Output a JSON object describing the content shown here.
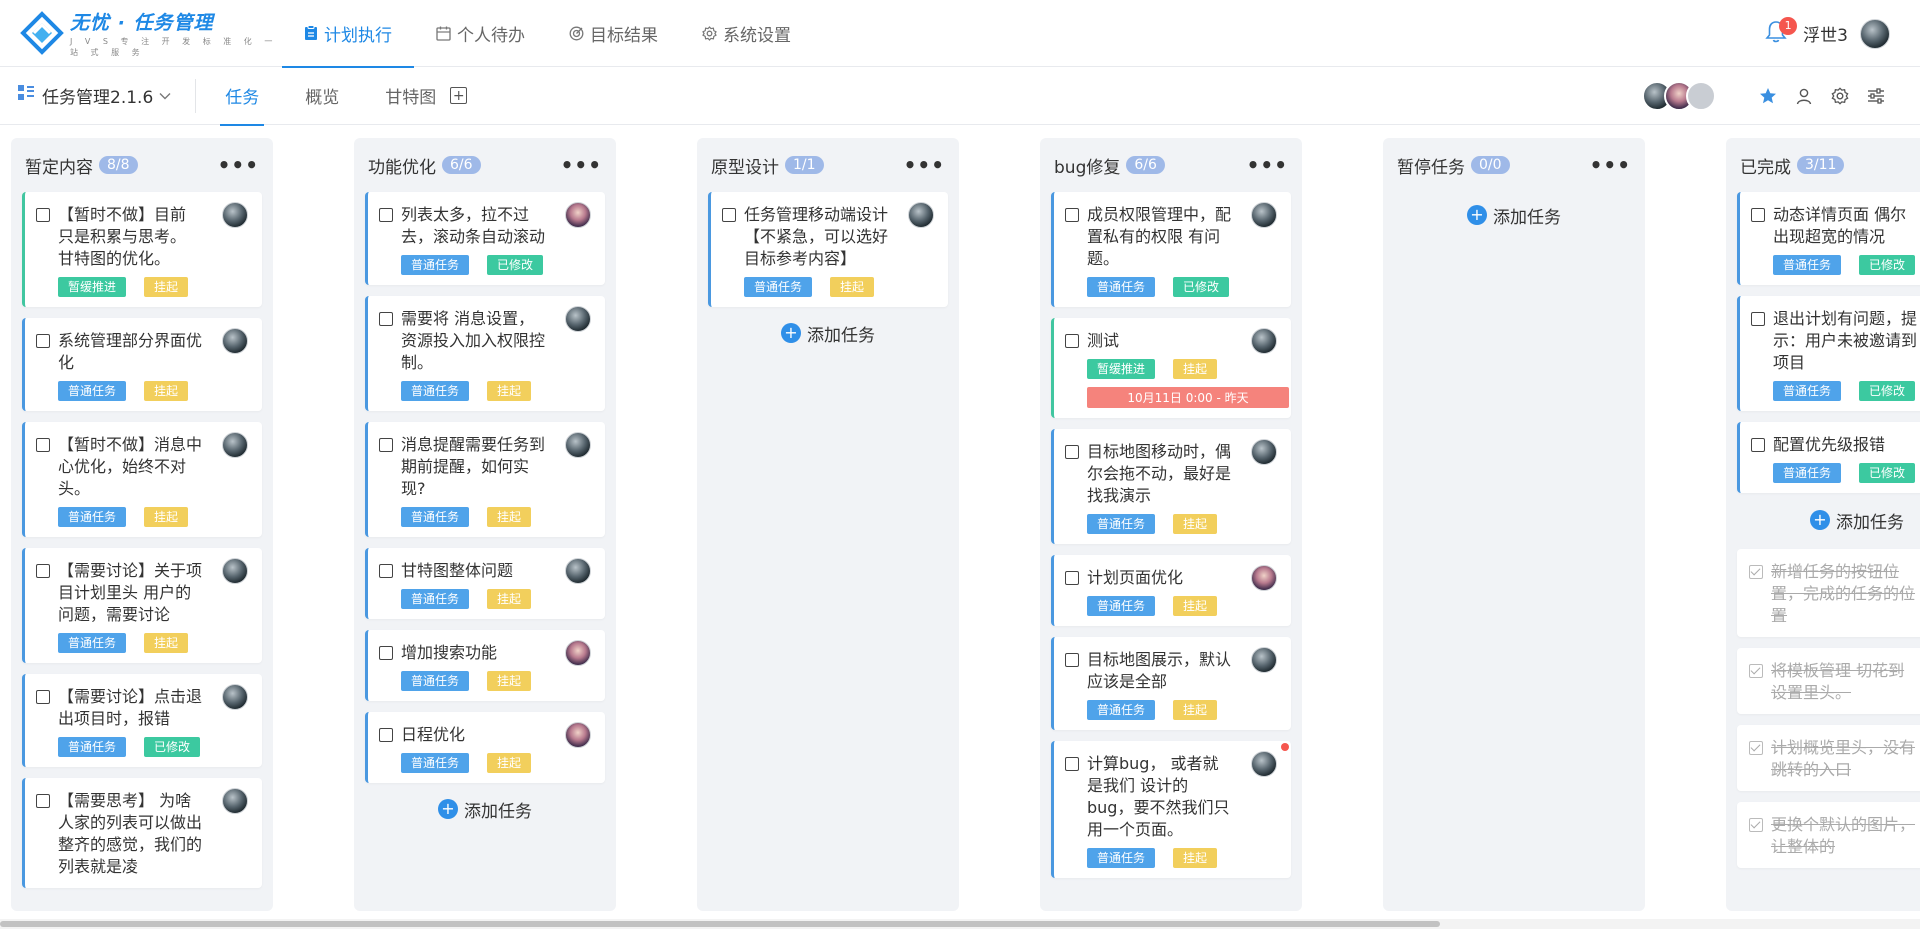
{
  "app": {
    "logo_title": "无忧 · 任务管理",
    "logo_subtitle": "J V S 专 注 开 发 标 准 化 一 站 式 服 务"
  },
  "nav": [
    {
      "label": "计划执行",
      "icon": "clipboard-icon",
      "active": true
    },
    {
      "label": "个人待办",
      "icon": "calendar-icon",
      "active": false
    },
    {
      "label": "目标结果",
      "icon": "target-icon",
      "active": false
    },
    {
      "label": "系统设置",
      "icon": "gear-icon",
      "active": false
    }
  ],
  "user": {
    "name": "浮世3",
    "notifications": "1"
  },
  "project": {
    "name": "任务管理2.1.6"
  },
  "subtabs": [
    {
      "label": "任务",
      "active": true
    },
    {
      "label": "概览",
      "active": false
    },
    {
      "label": "甘特图",
      "active": false
    }
  ],
  "colors": {
    "accent": "#1e88e5",
    "tag_blue": "#4fa3ea",
    "tag_green": "#3cc9a0",
    "tag_yellow": "#f2cf5c",
    "due_red": "#f5837c"
  },
  "add_task_label": "添加任务",
  "columns": [
    {
      "title": "暂定内容",
      "count": "8/8",
      "cards": [
        {
          "title": "【暂时不做】目前 只是积累与思考。 甘特图的优化。",
          "accent": "green",
          "tags": [
            {
              "t": "暂缓推进",
              "c": "green"
            },
            {
              "t": "挂起",
              "c": "yellow"
            }
          ]
        },
        {
          "title": "系统管理部分界面优化",
          "accent": "blue",
          "tags": [
            {
              "t": "普通任务",
              "c": "blue"
            },
            {
              "t": "挂起",
              "c": "yellow"
            }
          ]
        },
        {
          "title": "【暂时不做】消息中心优化，始终不对头。",
          "accent": "blue",
          "tags": [
            {
              "t": "普通任务",
              "c": "blue"
            },
            {
              "t": "挂起",
              "c": "yellow"
            }
          ]
        },
        {
          "title": "【需要讨论】关于项目计划里头 用户的问题，需要讨论",
          "accent": "blue",
          "tags": [
            {
              "t": "普通任务",
              "c": "blue"
            },
            {
              "t": "挂起",
              "c": "yellow"
            }
          ]
        },
        {
          "title": "【需要讨论】点击退出项目时，报错",
          "accent": "blue",
          "tags": [
            {
              "t": "普通任务",
              "c": "blue"
            },
            {
              "t": "已修改",
              "c": "green"
            }
          ]
        },
        {
          "title": "【需要思考】 为啥人家的列表可以做出整齐的感觉，我们的列表就是凌",
          "accent": "blue",
          "tags": []
        }
      ]
    },
    {
      "title": "功能优化",
      "count": "6/6",
      "add": true,
      "cards": [
        {
          "title": "列表太多，拉不过去，滚动条自动滚动",
          "accent": "blue",
          "avatar": "b",
          "tags": [
            {
              "t": "普通任务",
              "c": "blue"
            },
            {
              "t": "已修改",
              "c": "green"
            }
          ]
        },
        {
          "title": "需要将 消息设置，资源投入加入权限控制。",
          "accent": "blue",
          "tags": [
            {
              "t": "普通任务",
              "c": "blue"
            },
            {
              "t": "挂起",
              "c": "yellow"
            }
          ]
        },
        {
          "title": "消息提醒需要任务到期前提醒，如何实现?",
          "accent": "blue",
          "tags": [
            {
              "t": "普通任务",
              "c": "blue"
            },
            {
              "t": "挂起",
              "c": "yellow"
            }
          ]
        },
        {
          "title": "甘特图整体问题",
          "accent": "blue",
          "tags": [
            {
              "t": "普通任务",
              "c": "blue"
            },
            {
              "t": "挂起",
              "c": "yellow"
            }
          ]
        },
        {
          "title": "增加搜索功能",
          "accent": "blue",
          "avatar": "b",
          "tags": [
            {
              "t": "普通任务",
              "c": "blue"
            },
            {
              "t": "挂起",
              "c": "yellow"
            }
          ]
        },
        {
          "title": "日程优化",
          "accent": "blue",
          "avatar": "b",
          "tags": [
            {
              "t": "普通任务",
              "c": "blue"
            },
            {
              "t": "挂起",
              "c": "yellow"
            }
          ]
        }
      ]
    },
    {
      "title": "原型设计",
      "count": "1/1",
      "add": true,
      "cards": [
        {
          "title": "任务管理移动端设计【不紧急，可以选好 目标参考内容】",
          "accent": "blue",
          "tags": [
            {
              "t": "普通任务",
              "c": "blue"
            },
            {
              "t": "挂起",
              "c": "yellow"
            }
          ]
        }
      ]
    },
    {
      "title": "bug修复",
      "count": "6/6",
      "cards": [
        {
          "title": "成员权限管理中，配置私有的权限 有问题。",
          "accent": "blue",
          "tags": [
            {
              "t": "普通任务",
              "c": "blue"
            },
            {
              "t": "已修改",
              "c": "green"
            }
          ]
        },
        {
          "title": "测试",
          "accent": "green",
          "tags": [
            {
              "t": "暂缓推进",
              "c": "green"
            },
            {
              "t": "挂起",
              "c": "yellow"
            }
          ],
          "due": "10月11日 0:00 - 昨天"
        },
        {
          "title": "目标地图移动时，偶尔会拖不动，最好是找我演示",
          "accent": "blue",
          "tags": [
            {
              "t": "普通任务",
              "c": "blue"
            },
            {
              "t": "挂起",
              "c": "yellow"
            }
          ]
        },
        {
          "title": "计划页面优化",
          "accent": "blue",
          "avatar": "b",
          "tags": [
            {
              "t": "普通任务",
              "c": "blue"
            },
            {
              "t": "挂起",
              "c": "yellow"
            }
          ]
        },
        {
          "title": "目标地图展示，默认应该是全部",
          "accent": "blue",
          "tags": [
            {
              "t": "普通任务",
              "c": "blue"
            },
            {
              "t": "挂起",
              "c": "yellow"
            }
          ]
        },
        {
          "title": "计算bug， 或者就是我们 设计的bug，要不然我们只用一个页面。",
          "accent": "blue",
          "dot": true,
          "tags": [
            {
              "t": "普通任务",
              "c": "blue"
            },
            {
              "t": "挂起",
              "c": "yellow"
            }
          ]
        }
      ]
    },
    {
      "title": "暂停任务",
      "count": "0/0",
      "add": true,
      "add_top": true,
      "cards": []
    },
    {
      "title": "已完成",
      "count": "3/11",
      "add": true,
      "cards": [
        {
          "title": "动态详情页面 偶尔出现超宽的情况",
          "accent": "blue",
          "tags": [
            {
              "t": "普通任务",
              "c": "blue"
            },
            {
              "t": "已修改",
              "c": "green"
            }
          ]
        },
        {
          "title": "退出计划有问题，提示：用户未被邀请到项目",
          "accent": "blue",
          "tags": [
            {
              "t": "普通任务",
              "c": "blue"
            },
            {
              "t": "已修改",
              "c": "green"
            }
          ]
        },
        {
          "title": "配置优先级报错",
          "accent": "blue",
          "tags": [
            {
              "t": "普通任务",
              "c": "blue"
            },
            {
              "t": "已修改",
              "c": "green"
            }
          ]
        }
      ],
      "done_cards": [
        {
          "title": "新增任务的按钮位置，完成的任务的位置"
        },
        {
          "title": "将模板管理 切花到设置里头。"
        },
        {
          "title": "计划概览里头，没有跳转的入口"
        },
        {
          "title": "更换个默认的图片，让整体的"
        }
      ]
    }
  ]
}
